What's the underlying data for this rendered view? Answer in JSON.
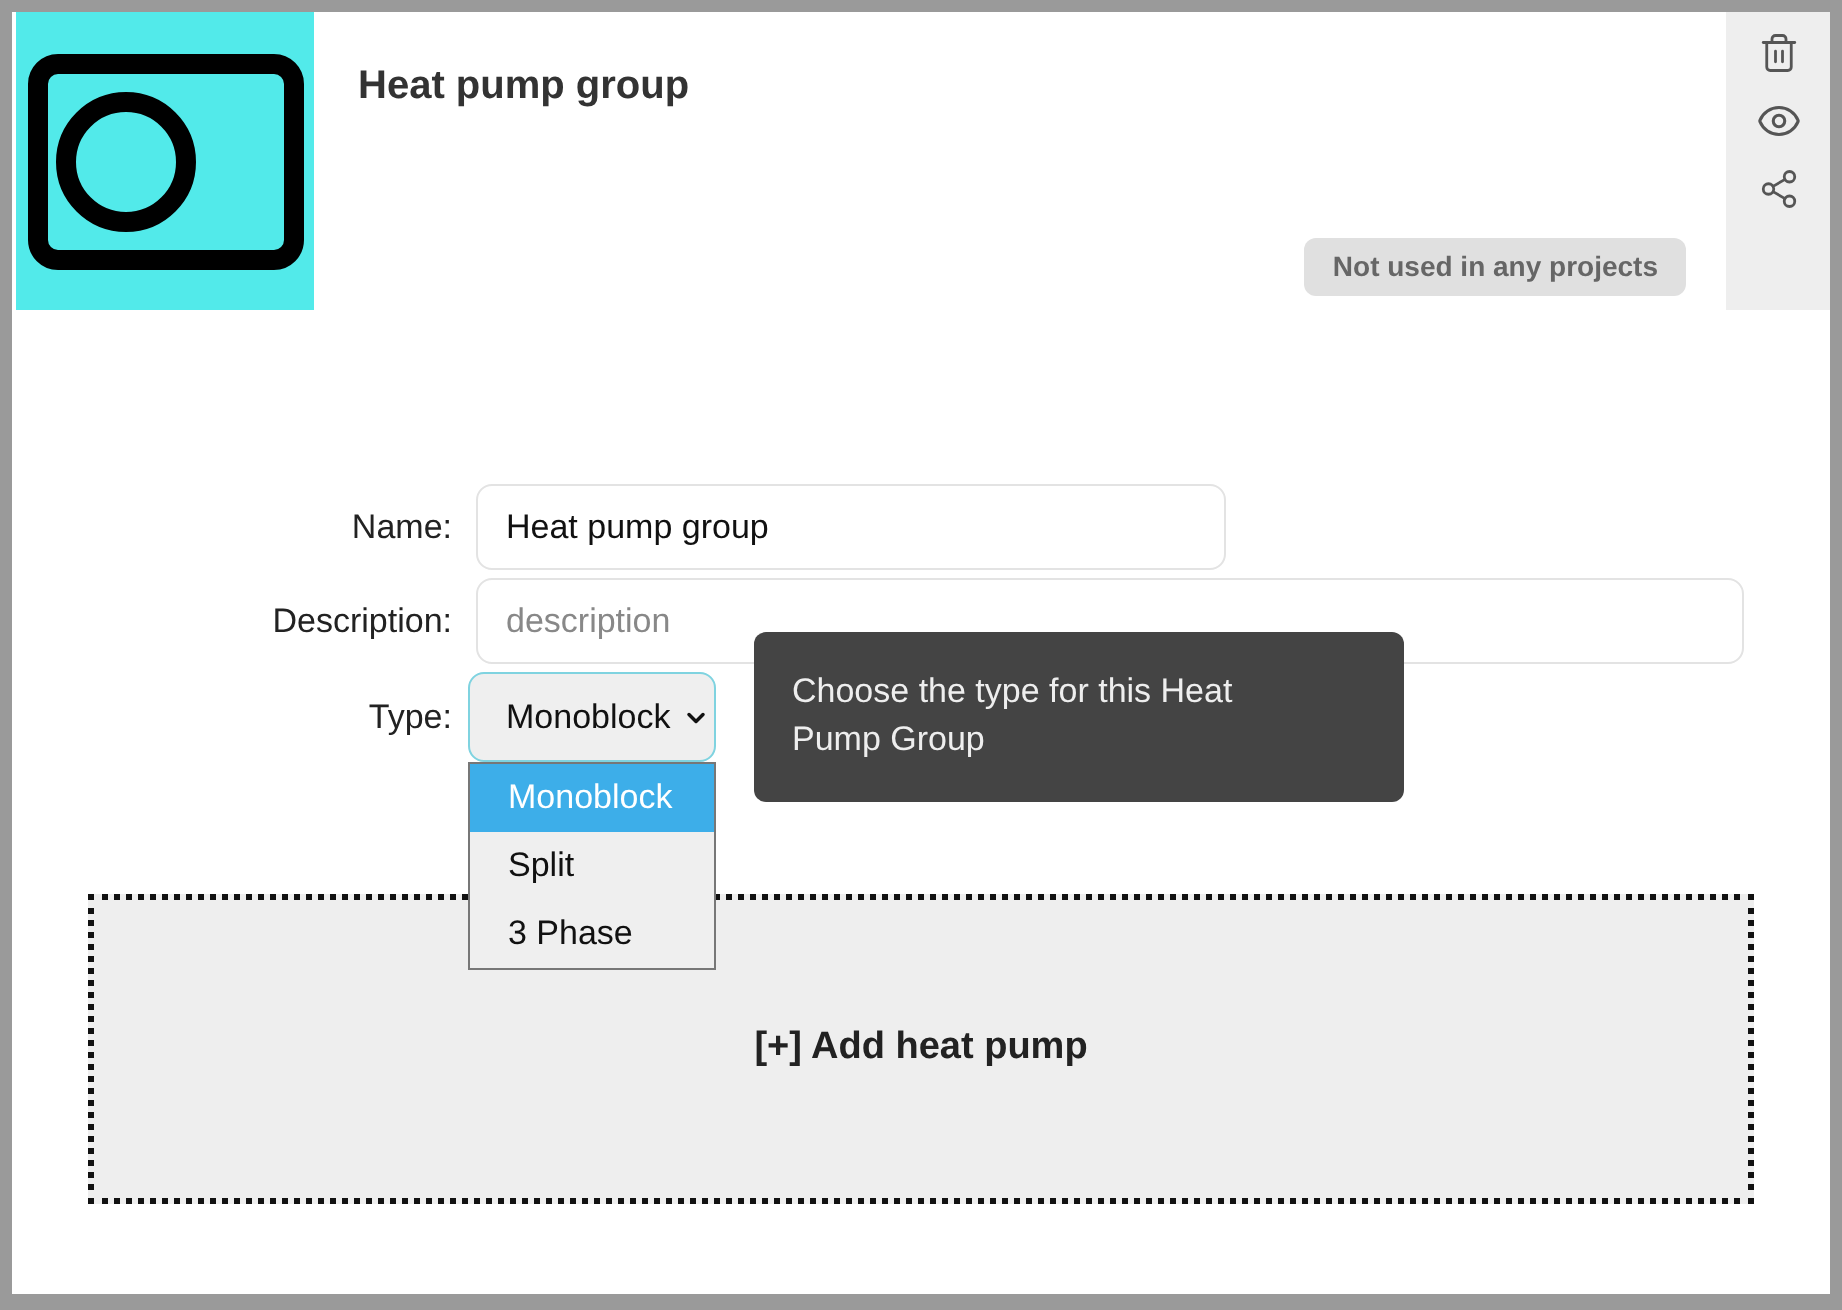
{
  "header": {
    "title": "Heat pump group",
    "usage_badge": "Not used in any projects"
  },
  "form": {
    "name": {
      "label": "Name:",
      "value": "Heat pump group"
    },
    "description": {
      "label": "Description:",
      "placeholder": "description"
    },
    "type": {
      "label": "Type:",
      "value": "Monoblock",
      "expanded": true,
      "options": [
        {
          "label": "Monoblock",
          "selected": true
        },
        {
          "label": "Split",
          "selected": false
        },
        {
          "label": "3 Phase",
          "selected": false
        }
      ]
    }
  },
  "tooltip": {
    "text": "Choose the type for this Heat Pump Group"
  },
  "add_area": {
    "label": "[+] Add heat pump"
  }
}
